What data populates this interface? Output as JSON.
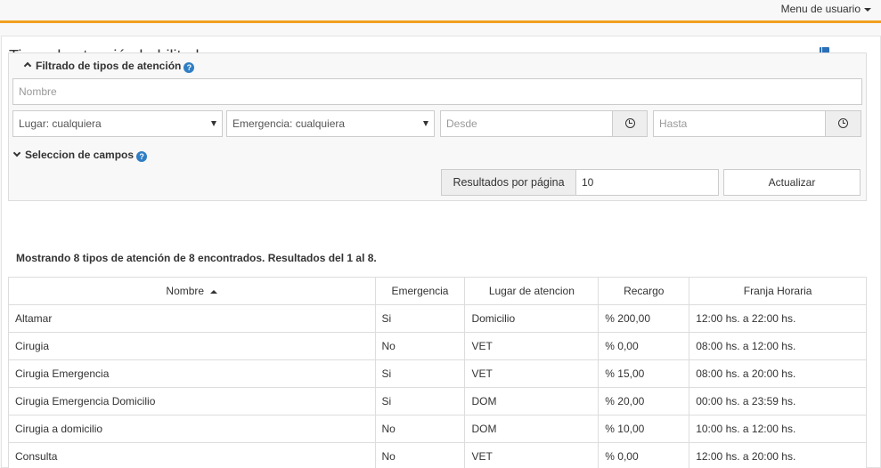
{
  "topbar": {
    "user_menu": "Menu de usuario"
  },
  "page": {
    "title": "Tipos de atención habilitados"
  },
  "filter": {
    "heading": "Filtrado de tipos de atención",
    "nombre_placeholder": "Nombre",
    "lugar_value": "Lugar: cualquiera",
    "emergencia_value": "Emergencia: cualquiera",
    "desde_placeholder": "Desde",
    "hasta_placeholder": "Hasta",
    "fields_heading": "Seleccion de campos",
    "page_size_label": "Resultados por página",
    "page_size_value": "10",
    "update_button": "Actualizar",
    "help_glyph": "?"
  },
  "summary": "Mostrando 8 tipos de atención de 8 encontrados. Resultados del 1 al 8.",
  "table": {
    "headers": [
      "Nombre",
      "Emergencia",
      "Lugar de atencion",
      "Recargo",
      "Franja Horaria"
    ],
    "rows": [
      [
        "Altamar",
        "Si",
        "Domicilio",
        "% 200,00",
        "12:00 hs. a 22:00 hs."
      ],
      [
        "Cirugia",
        "No",
        "VET",
        "% 0,00",
        "08:00 hs. a 12:00 hs."
      ],
      [
        "Cirugia Emergencia",
        "Si",
        "VET",
        "% 15,00",
        "08:00 hs. a 20:00 hs."
      ],
      [
        "Cirugia Emergencia Domicilio",
        "Si",
        "DOM",
        "% 20,00",
        "00:00 hs. a 23:59 hs."
      ],
      [
        "Cirugia a domicilio",
        "No",
        "DOM",
        "% 10,00",
        "10:00 hs. a 12:00 hs."
      ],
      [
        "Consulta",
        "No",
        "VET",
        "% 0,00",
        "12:00 hs. a 20:00 hs."
      ]
    ]
  },
  "colors": {
    "accent": "#f0a020",
    "help_icon": "#2f7ec4",
    "book_icon": "#2a6fb8"
  },
  "icons": [
    "chevron-up-icon",
    "chevron-down-icon",
    "help-icon",
    "clock-icon",
    "book-icon",
    "caret-down-icon",
    "sort-asc-icon"
  ]
}
